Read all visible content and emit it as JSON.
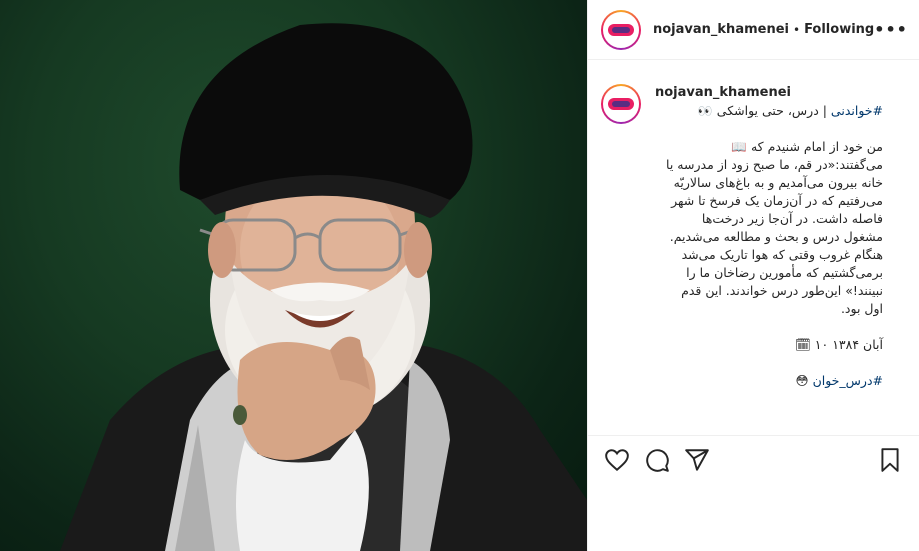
{
  "header": {
    "username": "nojavan_khamenei",
    "separator": "•",
    "follow_status": "Following",
    "more_label": "•••"
  },
  "caption": {
    "username": "nojavan_khamenei",
    "hashtag_title": "#خواندنی",
    "title_rest": " | درس، حتی یواشکی",
    "title_emoji": "👀",
    "book_emoji": "📖",
    "lines": [
      "من خود از امام شنیدم که",
      "می‌گفتند:«در قم، ما صبح زود از مدرسه یا",
      "خانه بیرون می‌آمدیم و به باغ‌های سالاریّه",
      "می‌رفتیم که در آن‌زمان یک فرسخ تا شهر",
      "فاصله داشت. در آن‌جا زیر درخت‌ها",
      "مشغول درس و بحث و مطالعه می‌شدیم.",
      "هنگام غروب وقتی که هوا تاریک می‌شد",
      "برمی‌گشتیم که مأمورین رضاخان ما را",
      "نبینند!» این‌طور درس خواندند. این قدم",
      "اول بود."
    ],
    "date_text": "آبان ۱۳۸۴",
    "date_marker": "۱۰",
    "calendar_emoji": "🗓",
    "hashtag_footer": "#درس_خوان",
    "footer_emoji": "😳"
  },
  "actions": {
    "like": "heart-icon",
    "comment": "comment-icon",
    "share": "share-icon",
    "save": "bookmark-icon"
  },
  "colors": {
    "link": "#00376b",
    "text": "#262626",
    "photo_bg": "#163a22"
  }
}
